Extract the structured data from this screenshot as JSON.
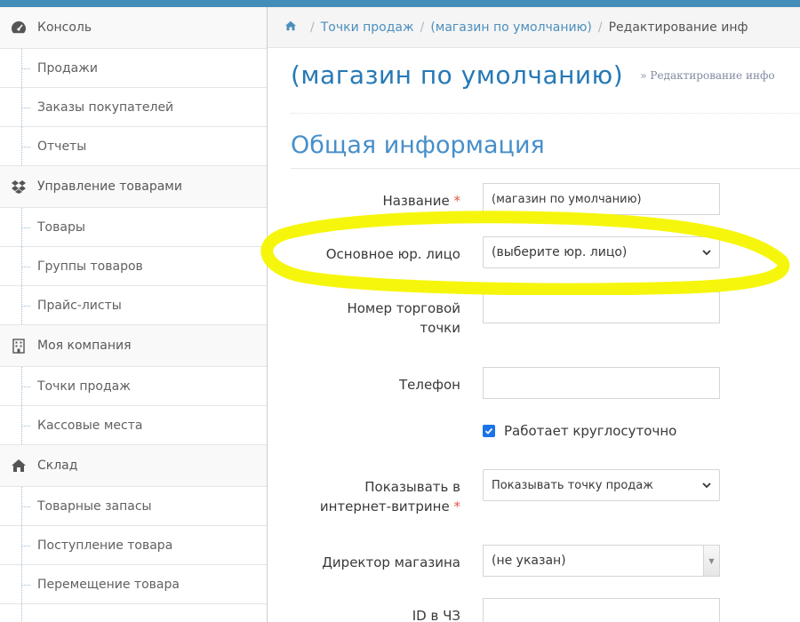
{
  "sidebar": {
    "items": [
      {
        "type": "section",
        "icon": "tachometer-icon",
        "label": "Консоль"
      },
      {
        "type": "sub",
        "label": "Продажи"
      },
      {
        "type": "sub",
        "label": "Заказы покупателей"
      },
      {
        "type": "sub",
        "label": "Отчеты"
      },
      {
        "type": "section",
        "icon": "dropbox-icon",
        "label": "Управление товарами"
      },
      {
        "type": "sub",
        "label": "Товары"
      },
      {
        "type": "sub",
        "label": "Группы товаров"
      },
      {
        "type": "sub",
        "label": "Прайс-листы"
      },
      {
        "type": "section",
        "icon": "building-icon",
        "label": "Моя компания"
      },
      {
        "type": "sub",
        "label": "Точки продаж"
      },
      {
        "type": "sub",
        "label": "Кассовые места"
      },
      {
        "type": "section",
        "icon": "home-icon",
        "label": "Склад"
      },
      {
        "type": "sub",
        "label": "Товарные запасы"
      },
      {
        "type": "sub",
        "label": "Поступление товара"
      },
      {
        "type": "sub",
        "label": "Перемещение товара"
      }
    ]
  },
  "breadcrumbs": {
    "home_icon": "home-icon",
    "item1": "Точки продаж",
    "item2": "(магазин по умолчанию)",
    "current": "Редактирование инф"
  },
  "page_header": {
    "title": "(магазин по умолчанию)",
    "subtitle": "» Редактирование инфо"
  },
  "section": {
    "title": "Общая информация"
  },
  "form": {
    "name_label": "Название",
    "name_value": "(магазин по умолчанию)",
    "required_mark": "*",
    "legal_label": "Основное юр. лицо",
    "legal_value": "(выберите юр. лицо)",
    "store_number_label_1": "Номер торговой",
    "store_number_label_2": "точки",
    "store_number_value": "",
    "phone_label": "Телефон",
    "phone_value": "",
    "allday_label": "Работает круглосуточно",
    "allday_checked": true,
    "show_label_1": "Показывать в",
    "show_label_2": "интернет-витрине",
    "show_value": "Показывать точку продаж",
    "director_label": "Директор магазина",
    "director_value": "(не указан)",
    "cz_label": "ID в ЧЗ",
    "cz_value": ""
  },
  "colors": {
    "accent": "#438eb9",
    "title_blue": "#2679b5",
    "highlight": "#f5f500",
    "required": "#dd5a43",
    "checkbox": "#1a73e8"
  }
}
